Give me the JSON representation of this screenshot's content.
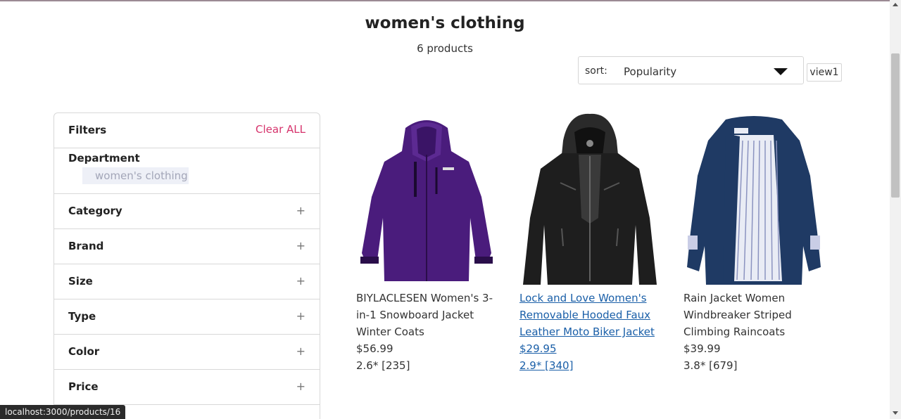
{
  "header": {
    "title": "women's clothing",
    "count": "6 products"
  },
  "sort": {
    "label": "sort:",
    "value": "Popularity",
    "view_label": "view1"
  },
  "filters": {
    "title": "Filters",
    "clear_label": "Clear ALL",
    "department": {
      "title": "Department",
      "selected": "women's clothing"
    },
    "items": [
      {
        "label": "Category",
        "toggle": "+"
      },
      {
        "label": "Brand",
        "toggle": "+"
      },
      {
        "label": "Size",
        "toggle": "+"
      },
      {
        "label": "Type",
        "toggle": "+"
      },
      {
        "label": "Color",
        "toggle": "+"
      },
      {
        "label": "Price",
        "toggle": "+"
      }
    ]
  },
  "products": [
    {
      "name": "BIYLACLESEN Women's 3-in-1 Snowboard Jacket Winter Coats",
      "price": "$56.99",
      "rating": "2.6* [235]",
      "color": "#4a1c7c",
      "icon": "purple-jacket-image"
    },
    {
      "name": "Lock and Love Women's Removable Hooded Faux Leather Moto Biker Jacket",
      "price": "$29.95",
      "rating": "2.9* [340]",
      "color": "#1e1e1e",
      "icon": "black-leather-jacket-image"
    },
    {
      "name": "Rain Jacket Women Windbreaker Striped Climbing Raincoats",
      "price": "$39.99",
      "rating": "3.8* [679]",
      "color": "#1f3a64",
      "icon": "navy-rain-jacket-image"
    }
  ],
  "status_bar": {
    "url": "localhost:3000/products/16"
  },
  "colors": {
    "accent": "#d6336c",
    "link": "#1a5fa8"
  }
}
